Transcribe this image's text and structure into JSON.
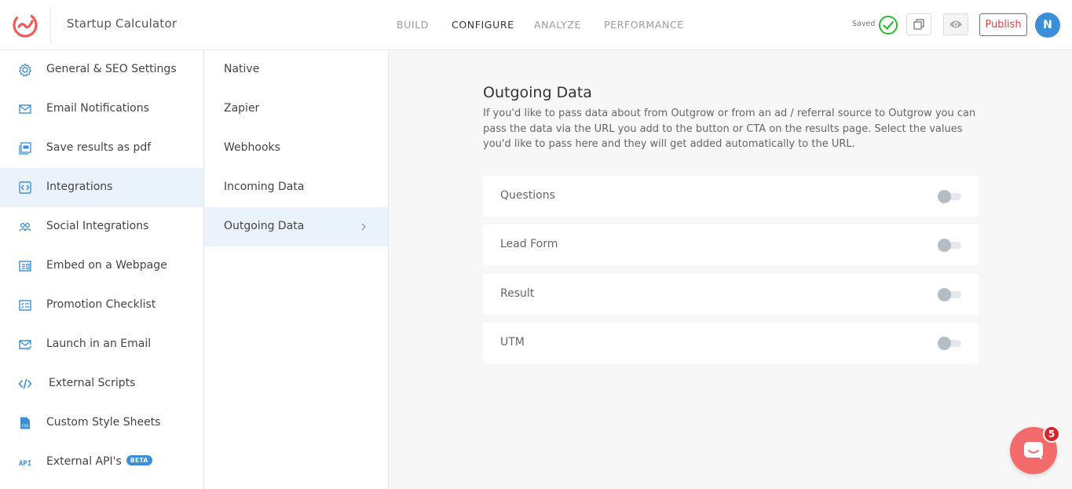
{
  "header": {
    "app_title": "Startup Calculator",
    "nav": [
      {
        "label": "BUILD",
        "active": false
      },
      {
        "label": "CONFIGURE",
        "active": true
      },
      {
        "label": "ANALYZE",
        "active": false
      },
      {
        "label": "PERFORMANCE",
        "active": false
      }
    ],
    "saved_label": "Saved",
    "publish_label": "Publish",
    "avatar_initial": "N"
  },
  "sidebar": {
    "items": [
      {
        "label": "General & SEO Settings",
        "icon": "gear-icon"
      },
      {
        "label": "Email Notifications",
        "icon": "envelope-icon"
      },
      {
        "label": "Save results as pdf",
        "icon": "pdf-icon"
      },
      {
        "label": "Integrations",
        "icon": "integrations-icon",
        "active": true
      },
      {
        "label": "Social Integrations",
        "icon": "users-icon"
      },
      {
        "label": "Embed on a Webpage",
        "icon": "embed-icon"
      },
      {
        "label": "Promotion Checklist",
        "icon": "checklist-icon"
      },
      {
        "label": "Launch in an Email",
        "icon": "mail-check-icon"
      },
      {
        "label": "External Scripts",
        "icon": "code-icon"
      },
      {
        "label": "Custom Style Sheets",
        "icon": "css-file-icon"
      },
      {
        "label": "External API's",
        "icon": "api-icon",
        "badge": "BETA"
      }
    ]
  },
  "submenu": {
    "items": [
      {
        "label": "Native"
      },
      {
        "label": "Zapier"
      },
      {
        "label": "Webhooks"
      },
      {
        "label": "Incoming Data"
      },
      {
        "label": "Outgoing Data",
        "active": true
      }
    ]
  },
  "main": {
    "title": "Outgoing Data",
    "description": "If you'd like to pass data about from Outgrow or from an ad / referral source to Outgrow you can pass the data via the URL you add to the button or CTA on the results page. Select the values you'd like to pass here and they will get added automatically to the URL.",
    "options": [
      {
        "label": "Questions",
        "enabled": false
      },
      {
        "label": "Lead Form",
        "enabled": false
      },
      {
        "label": "Result",
        "enabled": false
      },
      {
        "label": "UTM",
        "enabled": false
      }
    ]
  },
  "chat": {
    "badge_count": "5"
  },
  "colors": {
    "accent": "#3a8fd6",
    "publish": "#e04545",
    "chat": "#f26a6a",
    "saved_check": "#2eb82e",
    "logo": "#f05a5a"
  }
}
